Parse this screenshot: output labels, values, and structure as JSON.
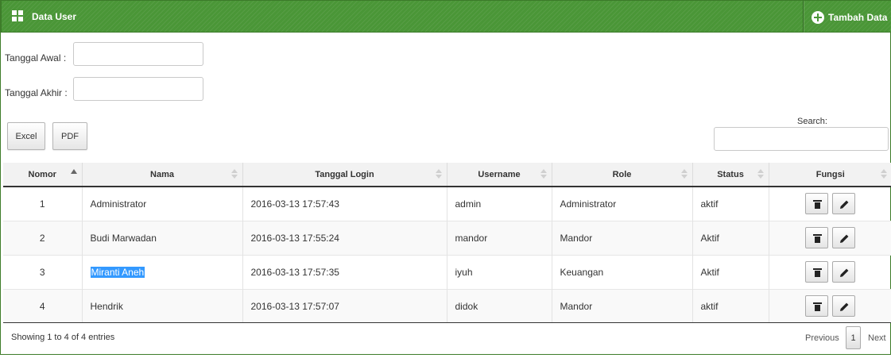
{
  "header": {
    "title": "Data User",
    "add_label": "Tambah Data",
    "brand_color": "#4a9637"
  },
  "filters": {
    "start_label": "Tanggal Awal :",
    "start_value": "",
    "end_label": "Tanggal Akhir :",
    "end_value": ""
  },
  "export": {
    "excel_label": "Excel",
    "pdf_label": "PDF"
  },
  "search": {
    "label": "Search:",
    "value": ""
  },
  "table": {
    "columns": [
      "Nomor",
      "Nama",
      "Tanggal Login",
      "Username",
      "Role",
      "Status",
      "Fungsi"
    ],
    "sorted_column": "Nomor",
    "sort_direction": "asc",
    "rows": [
      {
        "no": "1",
        "nama": "Administrator",
        "login": "2016-03-13 17:57:43",
        "username": "admin",
        "role": "Administrator",
        "status": "aktif"
      },
      {
        "no": "2",
        "nama": "Budi Marwadan",
        "login": "2016-03-13 17:55:24",
        "username": "mandor",
        "role": "Mandor",
        "status": "Aktif"
      },
      {
        "no": "3",
        "nama": "Miranti Aneh",
        "login": "2016-03-13 17:57:35",
        "username": "iyuh",
        "role": "Keuangan",
        "status": "Aktif"
      },
      {
        "no": "4",
        "nama": "Hendrik",
        "login": "2016-03-13 17:57:07",
        "username": "didok",
        "role": "Mandor",
        "status": "aktif"
      }
    ],
    "row_action_icons": [
      "trash-icon",
      "pencil-icon"
    ]
  },
  "footer": {
    "info": "Showing 1 to 4 of 4 entries",
    "previous": "Previous",
    "current_page": "1",
    "next": "Next"
  }
}
